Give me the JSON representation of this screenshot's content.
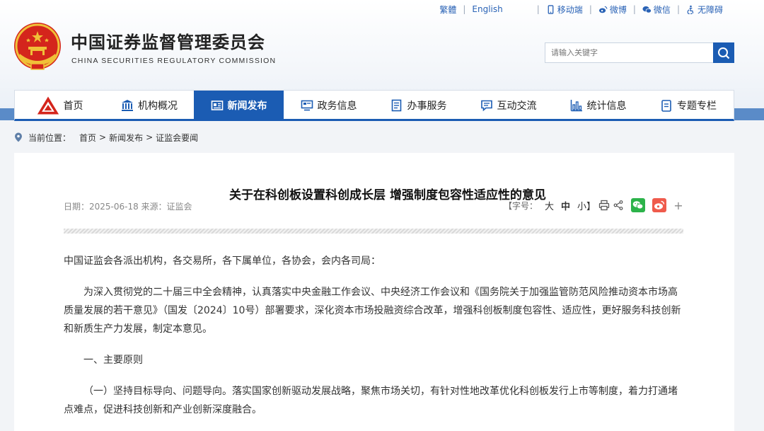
{
  "top_links": {
    "traditional": "繁體",
    "english": "English",
    "mobile": "移动端",
    "weibo": "微博",
    "wechat": "微信",
    "accessibility": "无障碍"
  },
  "header": {
    "title": "中国证券监督管理委员会",
    "subtitle": "CHINA SECURITIES REGULATORY COMMISSION",
    "search_placeholder": "请输入关键字"
  },
  "nav": {
    "items": [
      {
        "label": "首页",
        "icon": "csrc-logo-icon",
        "active": false
      },
      {
        "label": "机构概况",
        "icon": "building-icon",
        "active": false
      },
      {
        "label": "新闻发布",
        "icon": "newspaper-icon",
        "active": true
      },
      {
        "label": "政务信息",
        "icon": "monitor-icon",
        "active": false
      },
      {
        "label": "办事服务",
        "icon": "document-list-icon",
        "active": false
      },
      {
        "label": "互动交流",
        "icon": "chat-icon",
        "active": false
      },
      {
        "label": "统计信息",
        "icon": "bar-chart-icon",
        "active": false
      },
      {
        "label": "专题专栏",
        "icon": "clipboard-icon",
        "active": false
      }
    ]
  },
  "breadcrumb": {
    "prefix": "当前位置：",
    "items": [
      "首页",
      "新闻发布",
      "证监会要闻"
    ],
    "separator": ">"
  },
  "article": {
    "title": "关于在科创板设置科创成长层 增强制度包容性适应性的意见",
    "meta": "日期：2025-06-18 来源：证监会",
    "font_size_label": "【字号：",
    "font_sizes": [
      "大",
      "中",
      "小】"
    ],
    "paragraphs": [
      "中国证监会各派出机构，各交易所，各下属单位，各协会，会内各司局：",
      "为深入贯彻党的二十届三中全会精神，认真落实中央金融工作会议、中央经济工作会议和《国务院关于加强监管防范风险推动资本市场高质量发展的若干意见》（国发〔2024〕10号）部署要求，深化资本市场投融资综合改革，增强科创板制度包容性、适应性，更好服务科技创新和新质生产力发展，制定本意见。",
      "一、主要原则",
      "（一）坚持目标导向、问题导向。落实国家创新驱动发展战略，聚焦市场关切，有针对性地改革优化科创板发行上市等制度，着力打通堵点难点，促进科技创新和产业创新深度融合。"
    ]
  },
  "colors": {
    "primary_blue": "#1b5cb3",
    "link_blue": "#2a63b6",
    "wechat_green": "#2cb34a",
    "weibo_red": "#ef5b4c"
  }
}
